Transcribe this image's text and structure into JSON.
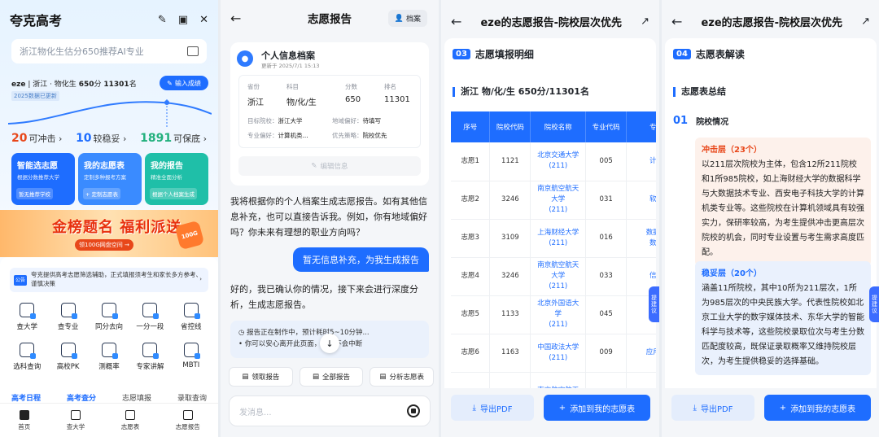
{
  "panel1": {
    "app_title": "夸克高考",
    "search_placeholder": "浙江物化生估分650推荐AI专业",
    "user": {
      "name": "eze",
      "province_subjects": "浙江 · 物化生",
      "score": "650",
      "score_unit": "分",
      "rank": "11301",
      "rank_unit": "名",
      "data_note": "2025数据已更新"
    },
    "enter_score_label": "输入成绩",
    "stats": [
      {
        "num": "20",
        "label": "可冲击 ›",
        "color": "#e8471a"
      },
      {
        "num": "10",
        "label": "较稳妥 ›",
        "color": "#1e6dff"
      },
      {
        "num": "1891",
        "label": "可保底 ›",
        "color": "#22b07d"
      }
    ],
    "cards": [
      {
        "title": "智能选志愿",
        "sub": "根据分数推荐大学",
        "badge": "暂无推荐学校",
        "color": "#1e6dff"
      },
      {
        "title": "我的志愿表",
        "sub": "定制多种报考方案",
        "badge": "+ 定制志愿表",
        "color": "#3a8bff"
      },
      {
        "title": "我的报告",
        "sub": "精准全面分析",
        "badge": "根据个人档案生成",
        "color": "#1fbfa8"
      }
    ],
    "banner": {
      "main": "金榜题名 福利派送",
      "sub": "领100G网盘空间 →",
      "coin": "100G"
    },
    "notice": {
      "tag": "公告",
      "text": "夸克提供高考志愿筛选辅助，正式填报须考生和家长多方参考、谨慎决策",
      "arrow": "›"
    },
    "tools": [
      "查大学",
      "查专业",
      "同分去向",
      "一分一段",
      "省控线",
      "选科查询",
      "高校PK",
      "测概率",
      "专家讲解",
      "MBTI"
    ],
    "subtabs": [
      "高考日程",
      "高考查分",
      "志愿填报",
      "录取查询"
    ],
    "bottom_nav": [
      "首页",
      "查大学",
      "志愿表",
      "志愿报告"
    ]
  },
  "panel2": {
    "title": "志愿报告",
    "archive_label": "档案",
    "profile": {
      "heading": "个人信息档案",
      "updated": "更新于 2025/7/1 15:13",
      "labels": [
        "省份",
        "科目",
        "分数",
        "排名"
      ],
      "values": [
        "浙江",
        "物/化/生",
        "650",
        "11301"
      ],
      "target_label": "目标院校：",
      "target_value": "浙江大学",
      "city_label": "地域偏好：",
      "city_value": "待填写",
      "major_label": "专业偏好：",
      "major_value": "计算机类...",
      "strategy_label": "优先策略：",
      "strategy_value": "院校优先",
      "edit_label": "编辑信息"
    },
    "ai_message_1": "我将根据你的个人档案生成志愿报告。如有其他信息补充，也可以直接告诉我。例如，你有地域偏好吗？你未来有理想的职业方向吗？",
    "user_message": "暂无信息补充，为我生成报告",
    "ai_message_2": "好的，我已确认你的情况，接下来会进行深度分析，生成志愿报告。",
    "status_line_1": "报告正在制作中，预计耗时5~10分钟...",
    "status_line_2": "你可以安心离开此页面，任务不会中断",
    "chips": [
      "领取报告",
      "全部报告",
      "分析志愿表"
    ],
    "input_placeholder": "发消息..."
  },
  "panel3": {
    "title": "eze的志愿报告-院校层次优先",
    "section_num": "03",
    "section_title": "志愿填报明细",
    "sub_header": "浙江    物/化/生    650分/11301名",
    "columns": [
      "序号",
      "院校代码",
      "院校名称",
      "专业代码",
      "专业"
    ],
    "rows": [
      [
        "志愿1",
        "1121",
        "北京交通大学\n(211)",
        "005",
        "计算"
      ],
      [
        "志愿2",
        "3246",
        "南京航空航天\n大学\n(211)",
        "031",
        "软件"
      ],
      [
        "志愿3",
        "3109",
        "上海财经大学\n(211)",
        "016",
        "数据科\n数据"
      ],
      [
        "志愿4",
        "3246",
        "南京航空航天\n大学\n(211)",
        "033",
        "信息"
      ],
      [
        "志愿5",
        "1133",
        "北京外国语大\n学\n(211)",
        "045",
        "计算"
      ],
      [
        "志愿6",
        "1163",
        "中国政法大学\n(211)",
        "009",
        "应用心"
      ],
      [
        "",
        "",
        "南京航空航天",
        "",
        ""
      ]
    ],
    "side_button": "提建议",
    "export_label": "导出PDF",
    "add_label": "添加到我的志愿表"
  },
  "panel4": {
    "title": "eze的志愿报告-院校层次优先",
    "section_num": "04",
    "section_title": "志愿表解读",
    "summary_title": "志愿表总结",
    "item_num": "01",
    "item_title": "院校情况",
    "tier1_head": "冲击层（23个）",
    "tier1_text": "以211层次院校为主体，包含12所211院校和1所985院校，如上海财经大学的数据科学与大数据技术专业、西安电子科技大学的计算机类专业等。这些院校在计算机领域具有较强实力，保研率较高，为考生提供冲击更高层次院校的机会，同时专业设置与考生需求高度匹配。",
    "tier2_head": "稳妥层（20个）",
    "tier2_text": "涵盖11所院校，其中10所为211层次，1所为985层次的中央民族大学。代表性院校如北京工业大学的数字媒体技术、东华大学的智能科学与技术等，这些院校录取位次与考生分数匹配度较高，既保证录取概率又维持院校层次，为考生提供稳妥的选择基础。",
    "side_button": "提建议",
    "export_label": "导出PDF",
    "add_label": "添加到我的志愿表"
  }
}
